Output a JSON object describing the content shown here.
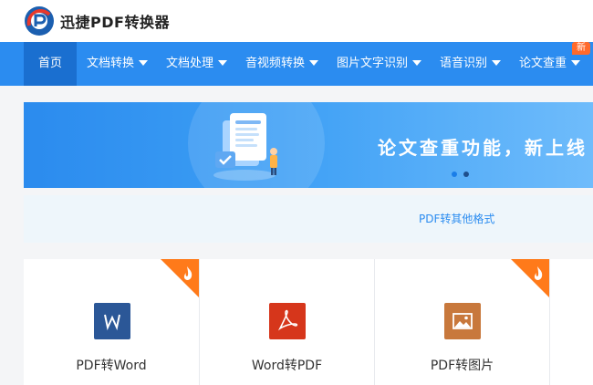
{
  "header": {
    "app_title": "迅捷PDF转换器"
  },
  "nav": {
    "items": [
      {
        "label": "首页",
        "active": true,
        "has_dropdown": false
      },
      {
        "label": "文档转换",
        "active": false,
        "has_dropdown": true
      },
      {
        "label": "文档处理",
        "active": false,
        "has_dropdown": true
      },
      {
        "label": "音视频转换",
        "active": false,
        "has_dropdown": true
      },
      {
        "label": "图片文字识别",
        "active": false,
        "has_dropdown": true
      },
      {
        "label": "语音识别",
        "active": false,
        "has_dropdown": true
      },
      {
        "label": "论文查重",
        "active": false,
        "has_dropdown": true
      }
    ],
    "new_badge": "新"
  },
  "banner": {
    "slogan": "论文查重功能，新上线",
    "slide_count": 2,
    "active_slide": 1
  },
  "subnav": {
    "tab_label": "PDF转其他格式"
  },
  "cards": [
    {
      "label": "PDF转Word",
      "icon": "word-icon",
      "icon_color": "#2b5797",
      "hot": true
    },
    {
      "label": "Word转PDF",
      "icon": "pdf-icon",
      "icon_color": "#d6361b",
      "hot": false
    },
    {
      "label": "PDF转图片",
      "icon": "image-icon",
      "icon_color": "#c8783c",
      "hot": true
    }
  ],
  "colors": {
    "nav_bg": "#2b8cf0",
    "nav_active_bg": "#1a6fd0",
    "hot_corner": "#ff7a1a",
    "accent": "#2b8cf0"
  }
}
